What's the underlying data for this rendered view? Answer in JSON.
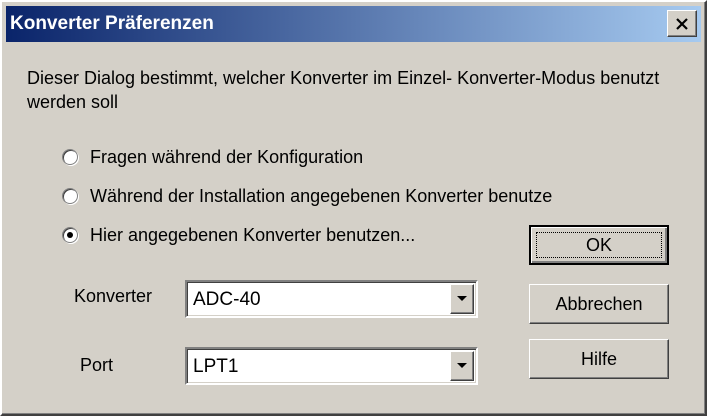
{
  "window": {
    "title": "Konverter Präferenzen",
    "close_symbol": "×"
  },
  "description": "Dieser Dialog bestimmt, welcher Konverter im Einzel- Konverter-Modus benutzt werden soll",
  "options": [
    {
      "label": "Fragen während der Konfiguration",
      "selected": false
    },
    {
      "label": "Während der Installation angegebenen Konverter benutze",
      "selected": false
    },
    {
      "label": "Hier angegebenen Konverter benutzen...",
      "selected": true
    }
  ],
  "fields": {
    "konverter": {
      "label": "Konverter",
      "value": "ADC-40"
    },
    "port": {
      "label": "Port",
      "value": "LPT1"
    }
  },
  "buttons": {
    "ok": "OK",
    "cancel": "Abbrechen",
    "help": "Hilfe"
  },
  "colors": {
    "titlebar_start": "#0a246a",
    "titlebar_end": "#a6caf0",
    "dialog_face": "#d4d0c8"
  },
  "icons": {
    "close": "close-icon",
    "dropdown": "chevron-down-icon",
    "radio": "radio-button"
  }
}
